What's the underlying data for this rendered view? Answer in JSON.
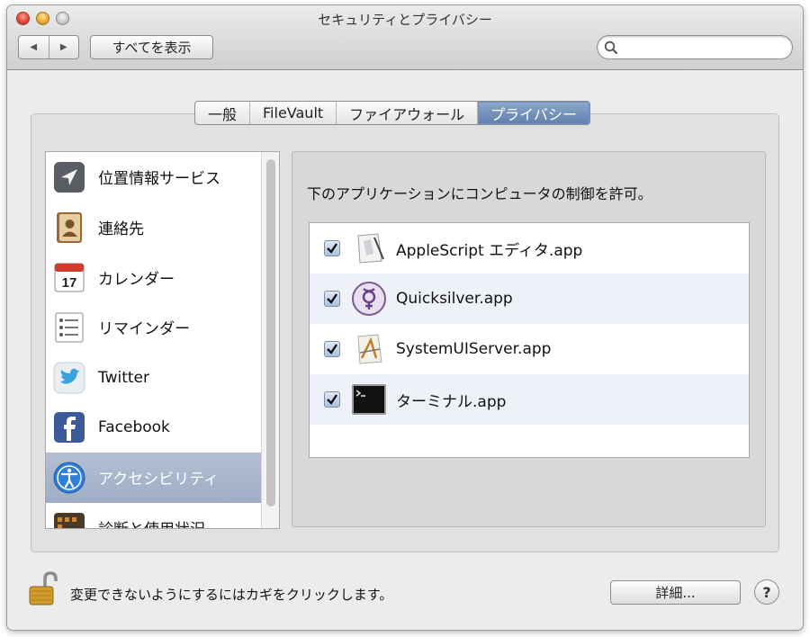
{
  "window": {
    "title": "セキュリティとプライバシー"
  },
  "toolbar": {
    "back_glyph": "◀",
    "forward_glyph": "▶",
    "show_all_label": "すべてを表示",
    "search": {
      "value": "",
      "placeholder": ""
    }
  },
  "tabs": [
    {
      "label": "一般",
      "active": false
    },
    {
      "label": "FileVault",
      "active": false
    },
    {
      "label": "ファイアウォール",
      "active": false
    },
    {
      "label": "プライバシー",
      "active": true
    }
  ],
  "categories": [
    {
      "label": "位置情報サービス",
      "icon": "location-icon",
      "selected": false
    },
    {
      "label": "連絡先",
      "icon": "contacts-icon",
      "selected": false
    },
    {
      "label": "カレンダー",
      "icon": "calendar-icon",
      "selected": false,
      "calendar_day": "17"
    },
    {
      "label": "リマインダー",
      "icon": "reminders-icon",
      "selected": false
    },
    {
      "label": "Twitter",
      "icon": "twitter-icon",
      "selected": false
    },
    {
      "label": "Facebook",
      "icon": "facebook-icon",
      "selected": false
    },
    {
      "label": "アクセシビリティ",
      "icon": "accessibility-icon",
      "selected": true
    },
    {
      "label": "診断と使用状況",
      "icon": "diagnostics-icon",
      "selected": false
    }
  ],
  "privacy_pane": {
    "instruction": "下のアプリケーションにコンピュータの制御を許可。",
    "apps": [
      {
        "label": "AppleScript エディタ.app",
        "checked": true,
        "icon": "applescript-editor-icon"
      },
      {
        "label": "Quicksilver.app",
        "checked": true,
        "icon": "quicksilver-icon"
      },
      {
        "label": "SystemUIServer.app",
        "checked": true,
        "icon": "systemuiserver-icon"
      },
      {
        "label": "ターミナル.app",
        "checked": true,
        "icon": "terminal-icon"
      }
    ]
  },
  "footer": {
    "lock_text": "変更できないようにするにはカギをクリックします。",
    "details_label": "詳細...",
    "help_label": "?"
  },
  "colors": {
    "selection": "#a8b5cc",
    "tab_active": "#6f8bb8",
    "window_bg": "#ececec"
  }
}
